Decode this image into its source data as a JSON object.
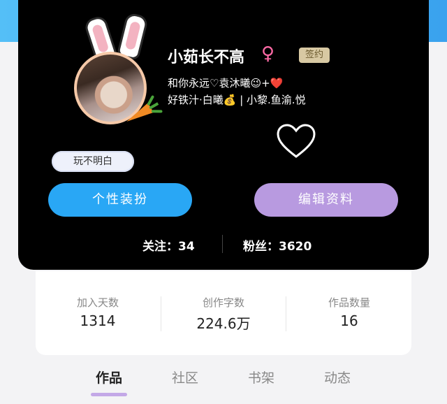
{
  "profile": {
    "avatar_badge": "玩不明白",
    "name": "小茹长不高",
    "gender_symbol": "♀",
    "sign_badge": "签约",
    "bio_line1": "和你永远♡袁沐曦😉+❤️",
    "bio_line2": "好铁汁·白曦💰 | 小黎.鱼渝.悦",
    "buttons": {
      "outfit": "个性装扮",
      "edit": "编辑资料"
    },
    "stats": {
      "following": "关注：34",
      "followers": "粉丝：3620"
    }
  },
  "info": {
    "days_label": "加入天数",
    "days_value": "1314",
    "words_label": "创作字数",
    "words_value": "224.6万",
    "works_label": "作品数量",
    "works_value": "16"
  },
  "tabs": [
    {
      "label": "作品",
      "active": true
    },
    {
      "label": "社区",
      "active": false
    },
    {
      "label": "书架",
      "active": false
    },
    {
      "label": "动态",
      "active": false
    }
  ],
  "colors": {
    "accent_blue": "#29a7f5",
    "accent_purple": "#b89ae0",
    "gender_pink": "#ff6aa6"
  }
}
